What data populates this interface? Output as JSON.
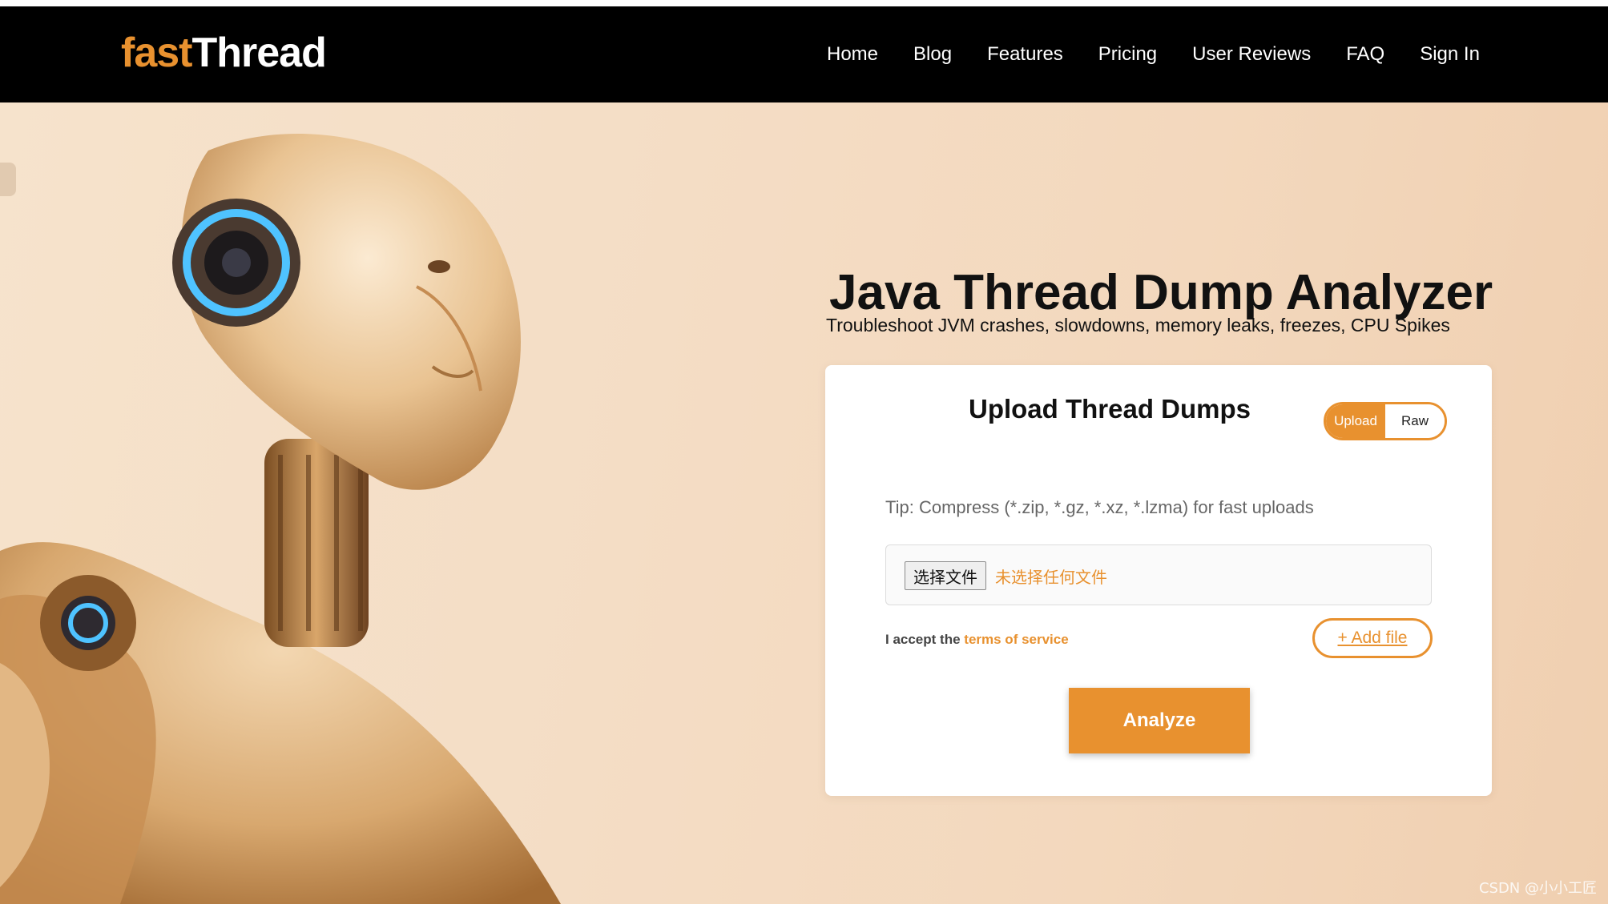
{
  "brand": {
    "part1": "fast",
    "part2": "Thread"
  },
  "nav": {
    "items": [
      "Home",
      "Blog",
      "Features",
      "Pricing",
      "User Reviews",
      "FAQ",
      "Sign In"
    ]
  },
  "hero": {
    "title": "Java Thread Dump Analyzer",
    "subtitle": "Troubleshoot JVM crashes, slowdowns, memory leaks, freezes, CPU Spikes"
  },
  "upload_card": {
    "title": "Upload Thread Dumps",
    "toggle": {
      "upload": "Upload",
      "raw": "Raw",
      "selected": "Upload"
    },
    "tip": "Tip: Compress (*.zip, *.gz, *.xz, *.lzma) for fast uploads",
    "file_button": "选择文件",
    "file_status": "未选择任何文件",
    "terms_prefix": "I accept the",
    "terms_link": "terms of service",
    "add_file": "+ Add file",
    "analyze": "Analyze"
  },
  "watermark": "CSDN @小小工匠",
  "colors": {
    "accent": "#e8912f",
    "navbar": "#000000",
    "card": "#ffffff"
  }
}
